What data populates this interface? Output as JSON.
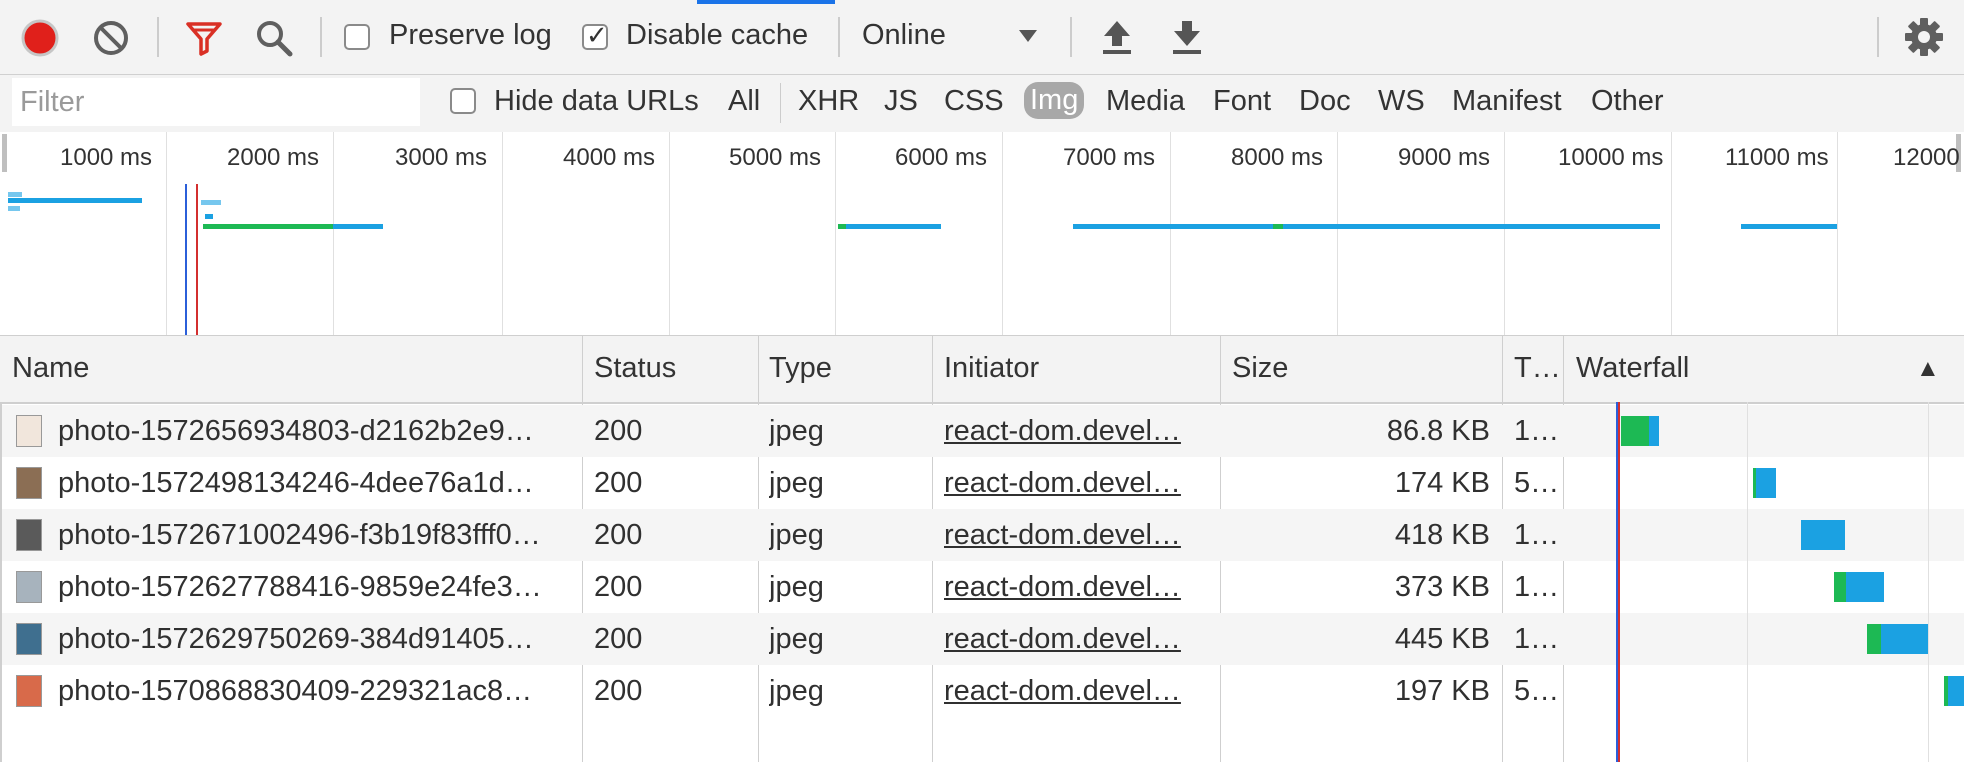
{
  "toolbar": {
    "record_icon": "record-icon",
    "clear_icon": "clear-icon",
    "filter_icon": "filter-icon",
    "search_icon": "search-icon",
    "preserve_log_label": "Preserve log",
    "preserve_log_checked": false,
    "disable_cache_label": "Disable cache",
    "disable_cache_checked": true,
    "throttle_value": "Online",
    "import_icon": "upload-icon",
    "export_icon": "download-icon",
    "settings_icon": "gear-icon",
    "record_color": "#e0201b",
    "filter_color": "#d93025"
  },
  "filterbar": {
    "filter_placeholder": "Filter",
    "hide_data_urls_label": "Hide data URLs",
    "types": [
      "All",
      "XHR",
      "JS",
      "CSS",
      "Img",
      "Media",
      "Font",
      "Doc",
      "WS",
      "Manifest",
      "Other"
    ],
    "selected_type": "Img"
  },
  "overview": {
    "ticks": [
      "1000 ms",
      "2000 ms",
      "3000 ms",
      "4000 ms",
      "5000 ms",
      "6000 ms",
      "7000 ms",
      "8000 ms",
      "9000 ms",
      "10000 ms",
      "11000 ms",
      "12000"
    ],
    "dom_content_loaded_color": "#2b5fd9",
    "load_color": "#d32f2f"
  },
  "table": {
    "columns": [
      "Name",
      "Status",
      "Type",
      "Initiator",
      "Size",
      "T…",
      "Waterfall"
    ],
    "sort_indicator": "▲",
    "rows": [
      {
        "name": "photo-1572656934803-d2162b2e9…",
        "status": "200",
        "type": "jpeg",
        "initiator": "react-dom.devel…",
        "size": "86.8 KB",
        "time": "1…",
        "thumb": "#d9a07a"
      },
      {
        "name": "photo-1572498134246-4dee76a1d…",
        "status": "200",
        "type": "jpeg",
        "initiator": "react-dom.devel…",
        "size": "174 KB",
        "time": "5…",
        "thumb": "#8b6e54"
      },
      {
        "name": "photo-1572671002496-f3b19f83fff0…",
        "status": "200",
        "type": "jpeg",
        "initiator": "react-dom.devel…",
        "size": "418 KB",
        "time": "1…",
        "thumb": "#5a5a5a"
      },
      {
        "name": "photo-1572627788416-9859e24fe3…",
        "status": "200",
        "type": "jpeg",
        "initiator": "react-dom.devel…",
        "size": "373 KB",
        "time": "1…",
        "thumb": "#a7b3bd"
      },
      {
        "name": "photo-1572629750269-384d91405…",
        "status": "200",
        "type": "jpeg",
        "initiator": "react-dom.devel…",
        "size": "445 KB",
        "time": "1…",
        "thumb": "#3f6f8f"
      },
      {
        "name": "photo-1570868830409-229321ac8…",
        "status": "200",
        "type": "jpeg",
        "initiator": "react-dom.devel…",
        "size": "197 KB",
        "time": "5…",
        "thumb": "#d86a4a"
      }
    ]
  },
  "colors": {
    "waiting": "#1db954",
    "download": "#1ba1e2"
  }
}
